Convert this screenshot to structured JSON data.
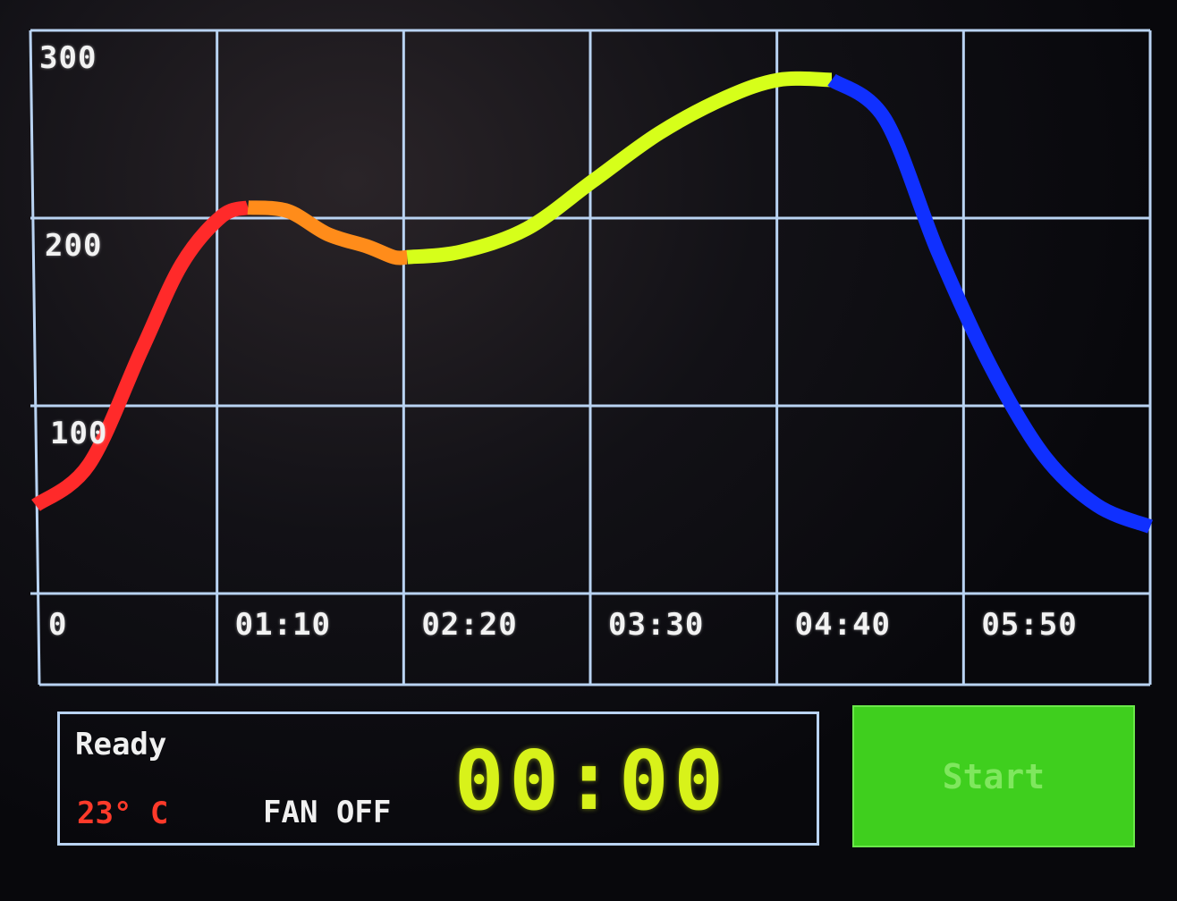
{
  "chart_data": {
    "type": "line",
    "y_tick_labels": [
      "300",
      "200",
      "100"
    ],
    "x_tick_labels": [
      "0",
      "01:10",
      "02:20",
      "03:30",
      "04:40",
      "05:50"
    ],
    "ylim": [
      0,
      300
    ],
    "xlim": [
      0,
      420
    ],
    "grid": true,
    "series": [
      {
        "color": "#ff2a2a",
        "x": [
          0,
          20,
          40,
          55,
          70,
          80
        ],
        "y": [
          22,
          45,
          110,
          158,
          185,
          190
        ]
      },
      {
        "color": "#ff8c1a",
        "x": [
          80,
          95,
          110,
          125,
          135,
          140
        ],
        "y": [
          190,
          188,
          175,
          168,
          162,
          162
        ]
      },
      {
        "color": "#d6ff1a",
        "x": [
          140,
          160,
          185,
          210,
          235,
          260,
          280,
          300
        ],
        "y": [
          162,
          165,
          178,
          205,
          232,
          252,
          262,
          262
        ]
      },
      {
        "color": "#1030ff",
        "x": [
          300,
          320,
          340,
          360,
          380,
          400,
          420
        ],
        "y": [
          262,
          240,
          165,
          100,
          50,
          22,
          10
        ]
      }
    ]
  },
  "colors": {
    "grid": "#b9d3f2",
    "timer": "#d8f21a",
    "temperature": "#ff3a2a",
    "start_button": "#3fcf1e"
  },
  "status": {
    "state": "Ready",
    "temperature": "23° C",
    "fan": "FAN OFF",
    "timer": "00:00"
  },
  "start_button": {
    "label": "Start"
  }
}
